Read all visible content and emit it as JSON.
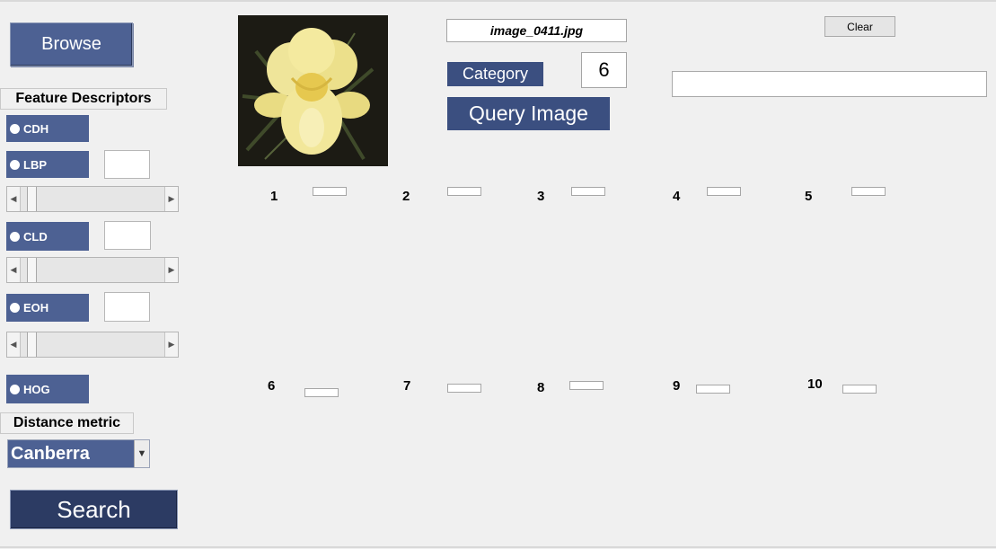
{
  "toolbar": {
    "browse_label": "Browse",
    "search_label": "Search",
    "clear_label": "Clear"
  },
  "features": {
    "heading": "Feature Descriptors",
    "items": [
      {
        "label": "CDH"
      },
      {
        "label": "LBP"
      },
      {
        "label": "CLD"
      },
      {
        "label": "EOH"
      },
      {
        "label": "HOG"
      }
    ]
  },
  "distance": {
    "heading": "Distance metric",
    "selected": "Canberra"
  },
  "query": {
    "filename": "image_0411.jpg",
    "category_label": "Category",
    "category_value": "6",
    "button_label": "Query Image"
  },
  "results": {
    "labels": [
      "1",
      "2",
      "3",
      "4",
      "5",
      "6",
      "7",
      "8",
      "9",
      "10"
    ]
  }
}
